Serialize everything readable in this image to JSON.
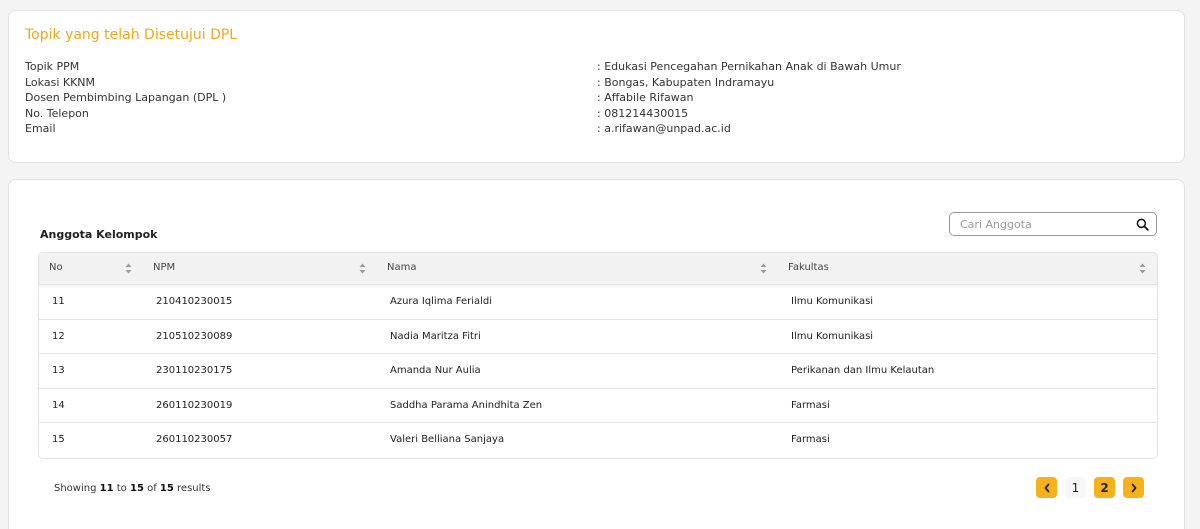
{
  "info": {
    "title": "Topik yang telah Disetujui DPL",
    "rows": [
      {
        "label": "Topik PPM",
        "value": ": Edukasi Pencegahan Pernikahan Anak di Bawah Umur"
      },
      {
        "label": "Lokasi KKNM",
        "value": ": Bongas, Kabupaten Indramayu"
      },
      {
        "label": "Dosen Pembimbing Lapangan (DPL )",
        "value": ": Affabile Rifawan"
      },
      {
        "label": "No. Telepon",
        "value": ": 081214430015"
      },
      {
        "label": "Email",
        "value": ": a.rifawan@unpad.ac.id"
      }
    ]
  },
  "members": {
    "title": "Anggota Kelompok",
    "search_placeholder": "Cari Anggota",
    "columns": [
      "No",
      "NPM",
      "Nama",
      "Fakultas"
    ],
    "rows": [
      {
        "no": "11",
        "npm": "210410230015",
        "nama": "Azura Iqlima Ferialdi",
        "fakultas": "Ilmu Komunikasi"
      },
      {
        "no": "12",
        "npm": "210510230089",
        "nama": "Nadia Maritza Fitri",
        "fakultas": "Ilmu Komunikasi"
      },
      {
        "no": "13",
        "npm": "230110230175",
        "nama": "Amanda Nur Aulia",
        "fakultas": "Perikanan dan Ilmu Kelautan"
      },
      {
        "no": "14",
        "npm": "260110230019",
        "nama": "Saddha Parama Anindhita Zen",
        "fakultas": "Farmasi"
      },
      {
        "no": "15",
        "npm": "260110230057",
        "nama": "Valeri Belliana Sanjaya",
        "fakultas": "Farmasi"
      }
    ]
  },
  "pagination": {
    "showing_prefix": "Showing",
    "from": "11",
    "to_word": "to",
    "to": "15",
    "of_word": "of",
    "total": "15",
    "results_word": "results",
    "pages": [
      "1",
      "2"
    ],
    "current_page": "2"
  },
  "colors": {
    "accent": "#f5b21a",
    "title_orange": "#f1a81a"
  },
  "icons": {
    "search": "search-icon",
    "sort": "sort-icon",
    "prev": "chevron-left-icon",
    "next": "chevron-right-icon"
  }
}
